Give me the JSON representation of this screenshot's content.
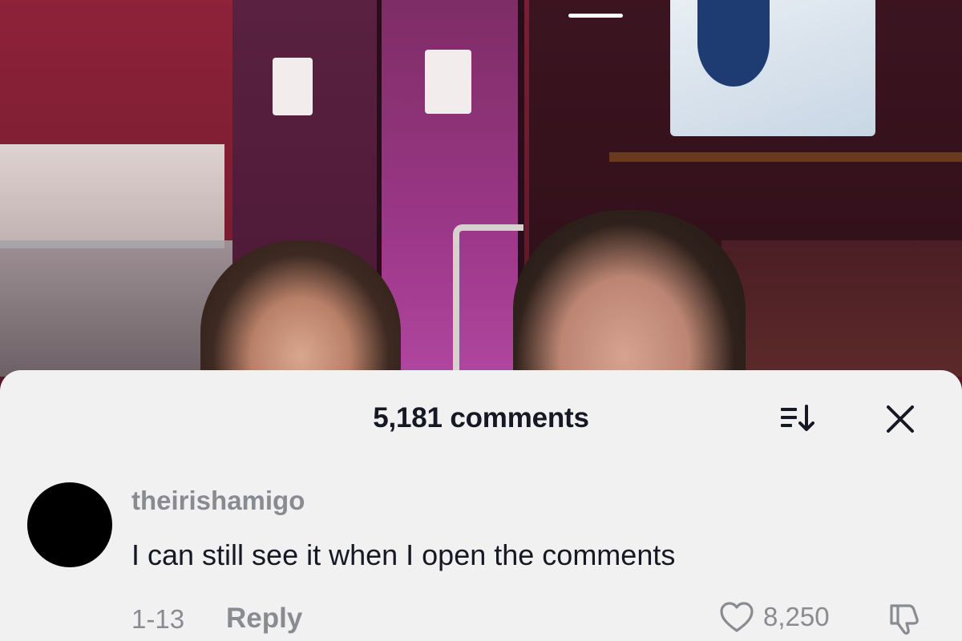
{
  "sheet": {
    "comment_count_label": "5,181 comments",
    "sort_icon": "sort-icon",
    "close_icon": "close-icon"
  },
  "comments": [
    {
      "username": "theirishamigo",
      "text": "I can still see it when I open the comments",
      "date": "1-13",
      "reply_label": "Reply",
      "like_count": "8,250",
      "like_icon": "heart-icon",
      "dislike_icon": "thumbs-down-icon"
    }
  ],
  "colors": {
    "sheet_background": "#f1f1f2",
    "primary_text": "#161823",
    "secondary_text": "#8a8b91"
  }
}
